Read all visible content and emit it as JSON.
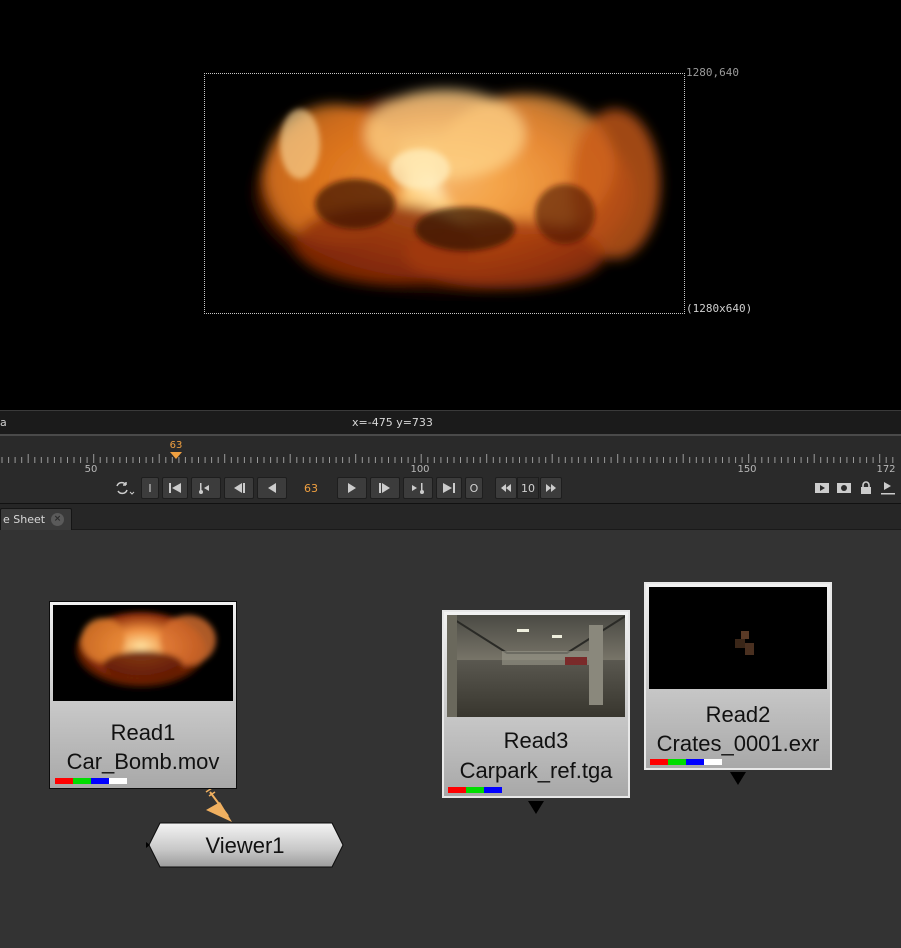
{
  "viewer": {
    "format_top_right": "1280,640",
    "format_bottom_right": "(1280x640)"
  },
  "info_bar": {
    "channel_fragment": "a",
    "coords": "x=-475 y=733"
  },
  "timeline": {
    "current_frame": "63",
    "tick_labels": [
      "50",
      "100",
      "150",
      "172"
    ]
  },
  "transport": {
    "frame_value": "63",
    "increment_value": "10",
    "in_label": "I",
    "out_label": "O"
  },
  "tabs": {
    "node_graph_label": "e Sheet",
    "close_symbol": "×"
  },
  "nodes": {
    "read1": {
      "name": "Read1",
      "file": "Car_Bomb.mov"
    },
    "read3": {
      "name": "Read3",
      "file": "Carpark_ref.tga"
    },
    "read2": {
      "name": "Read2",
      "file": "Crates_0001.exr"
    },
    "viewer1": {
      "name": "Viewer1"
    }
  },
  "colors": {
    "accent_orange": "#f0a040",
    "chip_red": "#ff0000",
    "chip_green": "#00dd00",
    "chip_blue": "#0000ff",
    "chip_white": "#ffffff"
  }
}
